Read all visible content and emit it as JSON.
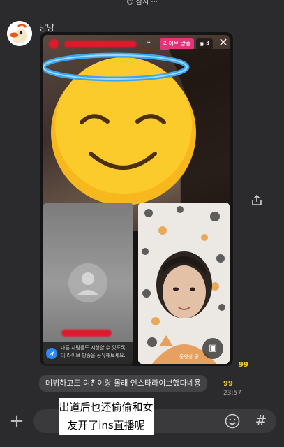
{
  "top_notice": "☺ 잠시 ···",
  "sender_name": "냥냥",
  "screenshot": {
    "live_badge": "라이브 방송",
    "viewer_count": "◉ 4",
    "info_text": "다른 사람들도 시청할 수 있도록 이 라이브 방송을 공유해보세요.",
    "cam_label": "동영상 공..."
  },
  "unread_count_1": "99",
  "message_text": "데뷔하고도 여친이랑 몰래 인스타라이브했다네용",
  "unread_count_2": "99",
  "timestamp": "23:57",
  "caption": "出道后也还偷偷和女友开了ins直播呢",
  "input": {
    "placeholder": ""
  },
  "icons": [
    "avatar-duck-icon",
    "share-icon",
    "plus-icon",
    "emoji-icon",
    "hash-icon",
    "close-icon",
    "qr-icon",
    "info-icon"
  ]
}
